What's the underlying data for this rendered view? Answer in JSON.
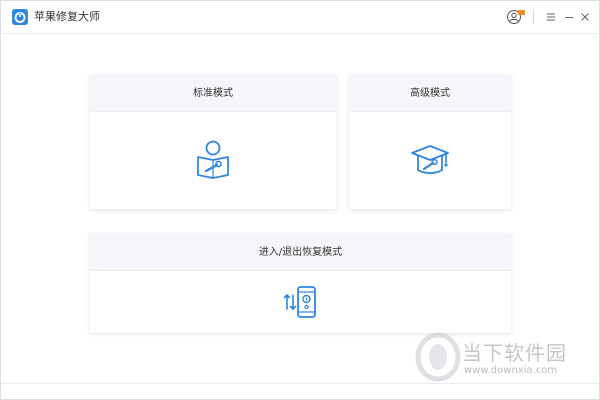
{
  "app": {
    "title": "苹果修复大师",
    "accent_color": "#2f86e0"
  },
  "titlebar": {
    "icons": [
      "app-logo-icon",
      "user-badge-icon",
      "menu-icon",
      "minimize-icon",
      "close-icon"
    ]
  },
  "cards": {
    "standard": {
      "label": "标准模式",
      "icon": "reader-wrench-icon"
    },
    "advanced": {
      "label": "高级模式",
      "icon": "graduation-cap-wrench-icon"
    },
    "recovery": {
      "label": "进入/退出恢复模式",
      "icon": "phone-swap-icon"
    }
  },
  "watermark": {
    "brand": "当下软件园",
    "url": "www.downxia.com"
  }
}
